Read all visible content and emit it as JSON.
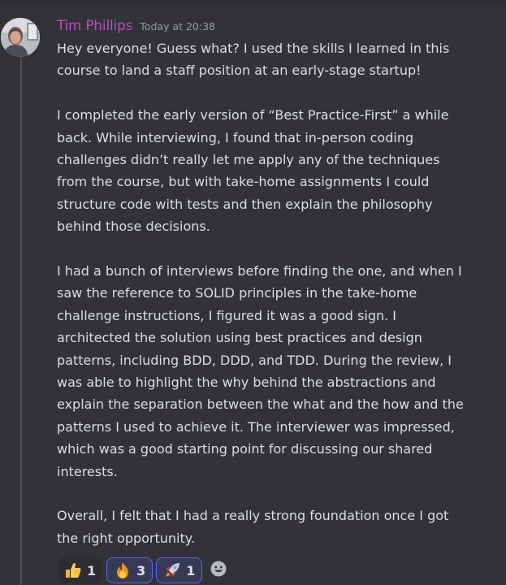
{
  "message": {
    "username": "Tim Phillips",
    "timestamp": "Today at 20:38",
    "paragraphs": [
      "Hey everyone! Guess what? I used the skills I learned in this\ncourse to land a staff position at an early-stage startup!",
      "I completed the early version of “Best Practice-First” a while\nback. While interviewing, I found that in-person coding\nchallenges didn’t really let me apply any of the techniques\nfrom the course, but with take-home assignments I could\nstructure code with tests and then explain the philosophy\nbehind those decisions.",
      "I had a bunch of interviews before finding the one, and when I\nsaw the reference to SOLID principles in the take-home\nchallenge instructions, I figured it was a good sign. I\narchitected the solution using best practices and design\npatterns, including BDD, DDD, and TDD. During the review, I\nwas able to highlight the why behind the abstractions and\nexplain the separation between the what and the how and the\npatterns I used to achieve it. The interviewer was impressed,\nwhich was a good starting point for discussing our shared\ninterests.",
      "Overall, I felt that I had a really strong foundation once I got\nthe right opportunity."
    ]
  },
  "reactions": [
    {
      "emoji": "thumbs-up",
      "count": "1",
      "active": false
    },
    {
      "emoji": "fire",
      "count": "3",
      "active": true
    },
    {
      "emoji": "rocket",
      "count": "1",
      "active": true
    }
  ],
  "colors": {
    "background": "#313338",
    "username": "#c646c6",
    "text": "#dbdee1",
    "timestamp": "#949ba4",
    "reaction_active_border": "#5865f2"
  }
}
